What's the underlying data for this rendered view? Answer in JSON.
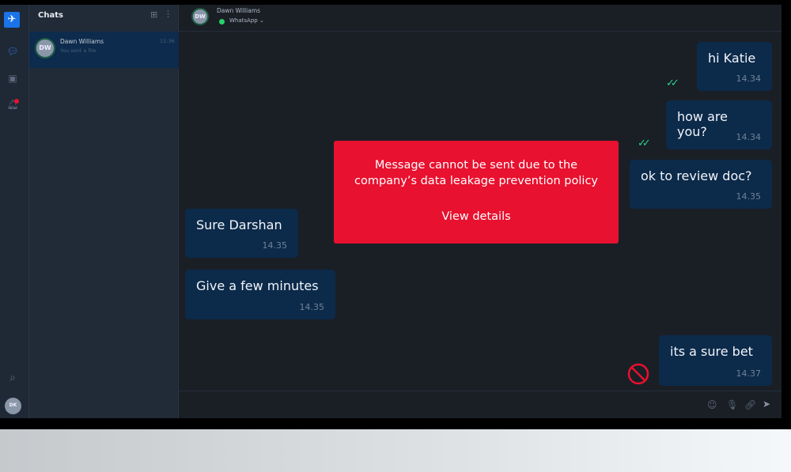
{
  "sidebar": {
    "avatar": "DK",
    "icons": [
      "logo-icon",
      "chat-icon",
      "contacts-icon",
      "bell-icon",
      "search-icon"
    ]
  },
  "chat_list": {
    "title": "Chats",
    "items": [
      {
        "initials": "DW",
        "name": "Dawn Williams",
        "preview": "You sent a file",
        "time": "11:36"
      }
    ]
  },
  "header": {
    "initials": "DW",
    "name": "Dawn Williams",
    "channel": "WhatsApp",
    "channel_color": "#25d366"
  },
  "messages": [
    {
      "text": "hi Katie",
      "time": "14.34",
      "dir": "out",
      "status": "read"
    },
    {
      "text": "how are you?",
      "time": "14.34",
      "dir": "out",
      "status": "read"
    },
    {
      "text": "ok to review doc?",
      "time": "14.35",
      "dir": "out"
    },
    {
      "text": "Sure Darshan",
      "time": "14.35",
      "dir": "in"
    },
    {
      "text": "Give a few minutes",
      "time": "14.35",
      "dir": "in"
    },
    {
      "text": "its a sure bet",
      "time": "14.37",
      "dir": "out",
      "status": "blocked"
    }
  ],
  "dlp_alert": {
    "line1": "Message cannot be sent due to the",
    "line2": "company’s data leakage prevention policy",
    "link": "View details",
    "color": "#e8112f"
  },
  "composer": {
    "icons": [
      "emoji-icon",
      "mic-icon",
      "attach-icon",
      "send-icon"
    ]
  }
}
